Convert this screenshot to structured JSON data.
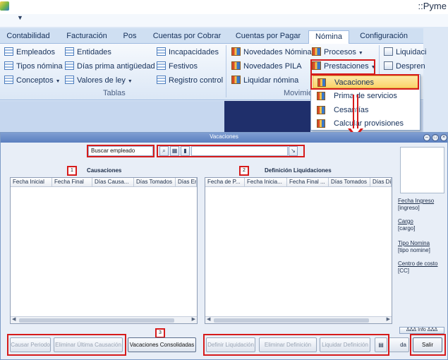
{
  "app": {
    "title": "::Pyme"
  },
  "ribbon_tabs": [
    {
      "label": "Contabilidad"
    },
    {
      "label": "Facturación"
    },
    {
      "label": "Pos"
    },
    {
      "label": "Cuentas por Cobrar"
    },
    {
      "label": "Cuentas por Pagar"
    },
    {
      "label": "Nómina"
    },
    {
      "label": "Configuración"
    }
  ],
  "ribbon": {
    "tablas": {
      "label": "Tablas",
      "items": [
        {
          "label": "Empleados"
        },
        {
          "label": "Tipos nómina"
        },
        {
          "label": "Conceptos"
        },
        {
          "label": "Entidades"
        },
        {
          "label": "Días prima antigüedad"
        },
        {
          "label": "Valores de ley"
        },
        {
          "label": "Incapacidades"
        },
        {
          "label": "Festivos"
        },
        {
          "label": "Registro control"
        }
      ]
    },
    "movimientos": {
      "label": "Movimie",
      "items": [
        {
          "label": "Novedades Nómina"
        },
        {
          "label": "Novedades PILA"
        },
        {
          "label": "Liquidar nómina"
        },
        {
          "label": "Procesos"
        },
        {
          "label": "Prestaciones"
        }
      ]
    },
    "extra": [
      {
        "label": "Liquidaci"
      },
      {
        "label": "Despren"
      }
    ]
  },
  "prestaciones_menu": [
    {
      "label": "Vacaciones"
    },
    {
      "label": "Prima de servicios"
    },
    {
      "label": "Cesantías"
    },
    {
      "label": "Calcular provisiones"
    }
  ],
  "dialog": {
    "title": "Vacaciones",
    "search": {
      "label": "Buscar empleado",
      "value": ""
    },
    "causaciones": {
      "badge": "1",
      "title": "Causaciones",
      "columns": [
        "Fecha Inicial",
        "Fecha Final",
        "Días Causa...",
        "Días Tomados",
        "Días En"
      ]
    },
    "liquidaciones": {
      "badge": "2",
      "title": "Definición Liquidaciones",
      "columns": [
        "Fecha de P...",
        "Fecha Inicia...",
        "Fecha Final ...",
        "Días Tomados",
        "Días Dis"
      ]
    },
    "employee_info": [
      {
        "label": "Fecha Ingreso",
        "value": "[ingreso]"
      },
      {
        "label": "Cargo",
        "value": "[cargo]"
      },
      {
        "label": "Tipo Nomina",
        "value": "[tipo nomine]"
      },
      {
        "label": "Centro de costo",
        "value": "[CC]"
      }
    ],
    "info_toggle": "ᐃᐃᐃ Info ᐃᐃᐃ",
    "badge3": "3",
    "buttons": {
      "causar": "Causar Periodo",
      "eliminar_causacion": "Eliminar Última Causación",
      "consolidadas": "Vacaciones Consolidadas",
      "definir": "Definir Liquidación",
      "eliminar_definicion": "Eliminar Definición",
      "liquidar": "Liquidar Definición",
      "ayuda": "da",
      "salir": "Salir"
    }
  }
}
